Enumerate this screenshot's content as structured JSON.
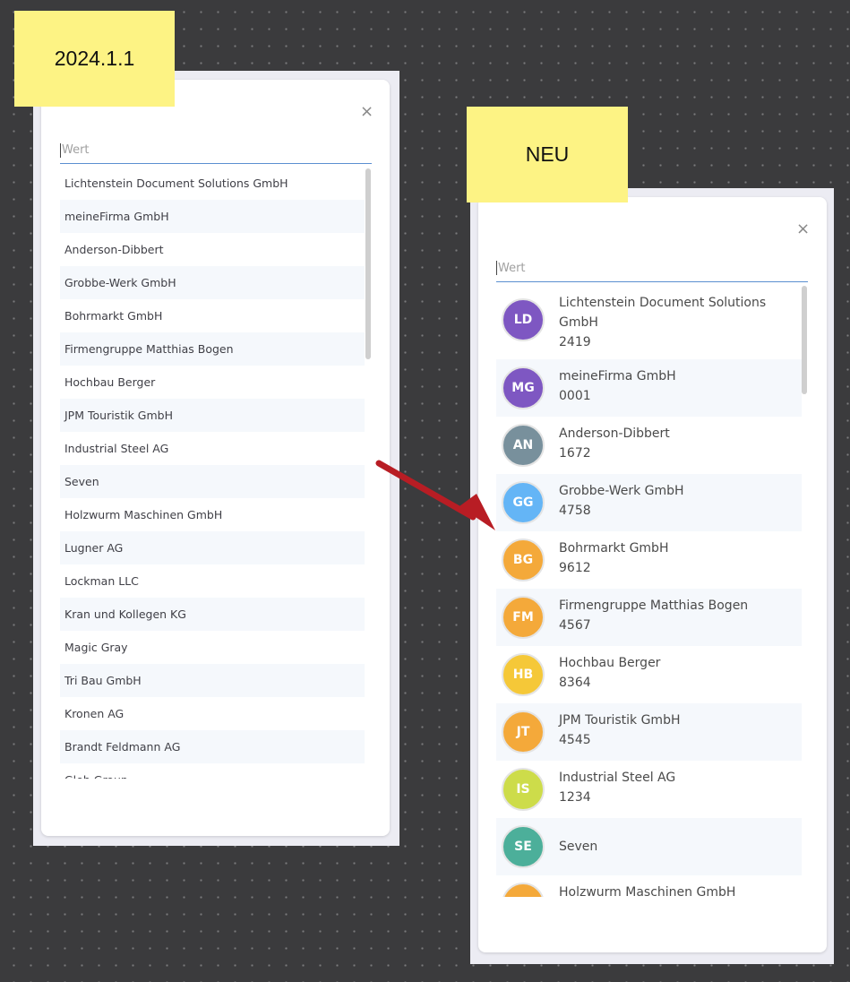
{
  "old_panel": {
    "label": "2024.1.1",
    "search_placeholder": "Wert",
    "close_symbol": "×",
    "items": [
      "Lichtenstein Document Solutions GmbH",
      "meineFirma GmbH",
      "Anderson-Dibbert",
      "Grobbe-Werk GmbH",
      "Bohrmarkt GmbH",
      "Firmengruppe Matthias Bogen",
      "Hochbau Berger",
      "JPM Touristik GmbH",
      "Industrial Steel AG",
      "Seven",
      "Holzwurm Maschinen GmbH",
      "Lugner AG",
      "Lockman LLC",
      "Kran und Kollegen KG",
      "Magic Gray",
      "Tri Bau GmbH",
      "Kronen AG",
      "Brandt Feldmann AG",
      "Gleb Group"
    ]
  },
  "new_panel": {
    "label": "NEU",
    "search_placeholder": "Wert",
    "close_symbol": "×",
    "items": [
      {
        "initials": "LD",
        "name": "Lichtenstein Document Solutions GmbH",
        "number": "2419",
        "color": "#7e57c2"
      },
      {
        "initials": "MG",
        "name": "meineFirma GmbH",
        "number": "0001",
        "color": "#7e57c2"
      },
      {
        "initials": "AN",
        "name": "Anderson-Dibbert",
        "number": "1672",
        "color": "#78909c"
      },
      {
        "initials": "GG",
        "name": "Grobbe-Werk GmbH",
        "number": "4758",
        "color": "#64b5f6"
      },
      {
        "initials": "BG",
        "name": "Bohrmarkt GmbH",
        "number": "9612",
        "color": "#f4a93a"
      },
      {
        "initials": "FM",
        "name": "Firmengruppe Matthias Bogen",
        "number": "4567",
        "color": "#f4a93a"
      },
      {
        "initials": "HB",
        "name": "Hochbau Berger",
        "number": "8364",
        "color": "#f5c838"
      },
      {
        "initials": "JT",
        "name": "JPM Touristik GmbH",
        "number": "4545",
        "color": "#f4a93a"
      },
      {
        "initials": "IS",
        "name": "Industrial Steel AG",
        "number": "1234",
        "color": "#cddc4a"
      },
      {
        "initials": "SE",
        "name": "Seven",
        "number": "",
        "color": "#4caf9a"
      },
      {
        "initials": "",
        "name": "Holzwurm Maschinen GmbH",
        "number": "",
        "color": "#f4a93a"
      }
    ]
  },
  "colors": {
    "sticky_note": "#fdf384",
    "arrow": "#b81d24",
    "search_underline": "#5b8fd0"
  }
}
